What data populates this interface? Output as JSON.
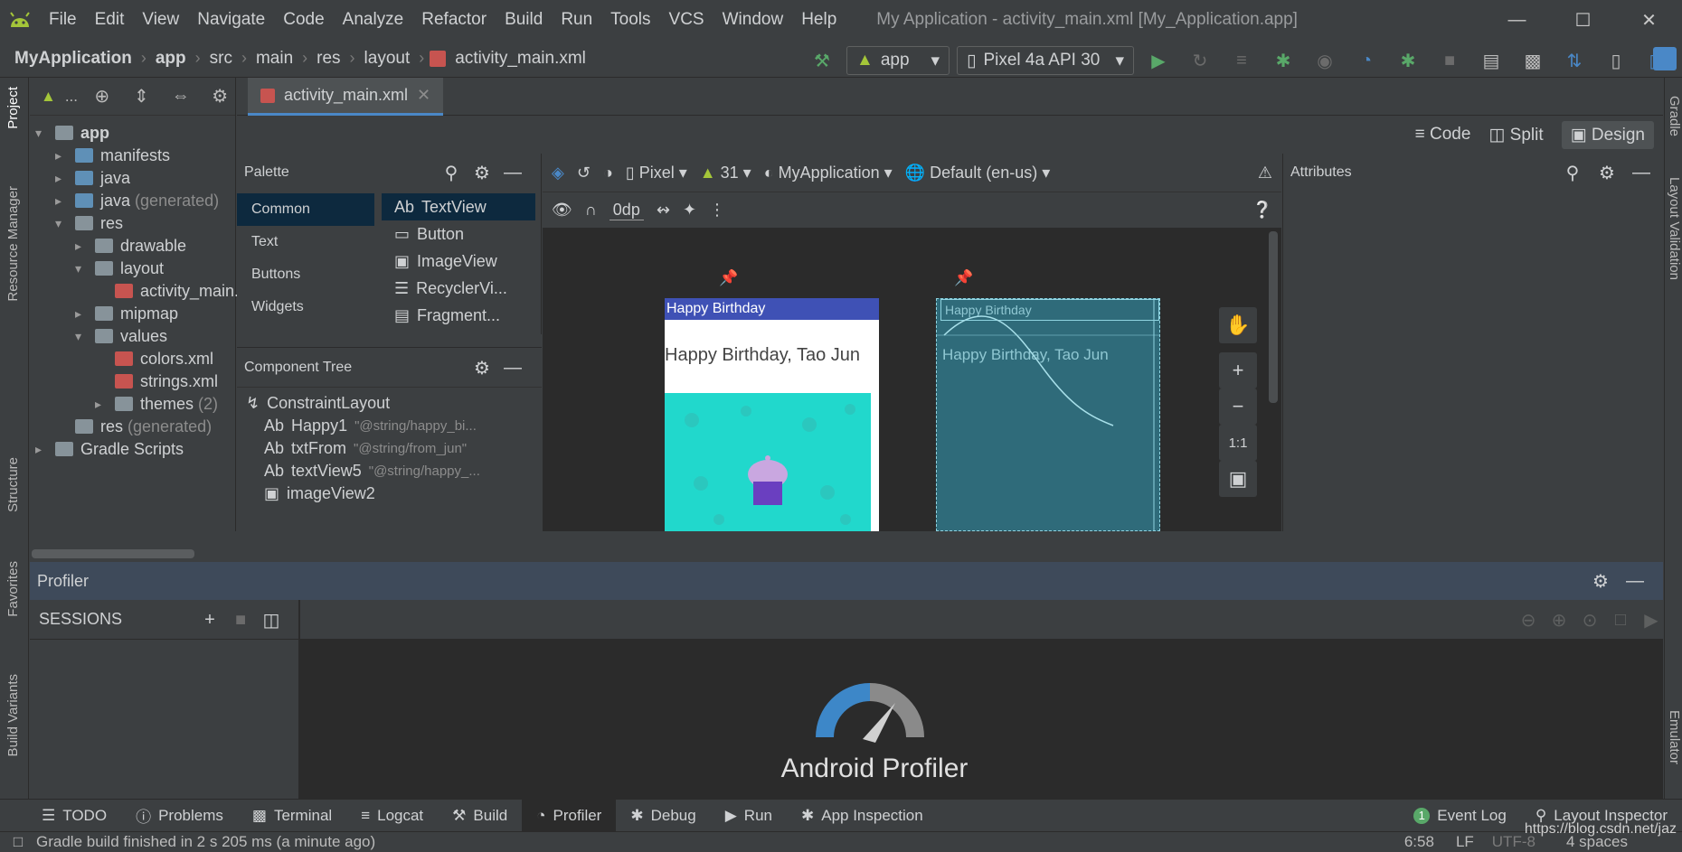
{
  "menubar": {
    "items": [
      "File",
      "Edit",
      "View",
      "Navigate",
      "Code",
      "Analyze",
      "Refactor",
      "Build",
      "Run",
      "Tools",
      "VCS",
      "Window",
      "Help"
    ],
    "title": "My Application - activity_main.xml [My_Application.app]"
  },
  "navbar": {
    "breadcrumbs": [
      "MyApplication",
      "app",
      "src",
      "main",
      "res",
      "layout",
      "activity_main.xml"
    ],
    "run_config": "app",
    "device": "Pixel 4a API 30"
  },
  "left_strip": {
    "project": "Project",
    "resource_manager": "Resource Manager",
    "structure": "Structure",
    "favorites": "Favorites",
    "build_variants": "Build Variants"
  },
  "right_strip": {
    "gradle": "Gradle",
    "layout_validation": "Layout Validation",
    "emulator": "Emulator"
  },
  "project": {
    "toolbar_label": "...",
    "tree": [
      {
        "label": "app"
      },
      {
        "label": "manifests"
      },
      {
        "label": "java"
      },
      {
        "label": "java",
        "suffix": "(generated)"
      },
      {
        "label": "res"
      },
      {
        "label": "drawable"
      },
      {
        "label": "layout"
      },
      {
        "label": "activity_main.xml"
      },
      {
        "label": "mipmap"
      },
      {
        "label": "values"
      },
      {
        "label": "colors.xml"
      },
      {
        "label": "strings.xml"
      },
      {
        "label": "themes",
        "suffix": "(2)"
      },
      {
        "label": "res",
        "suffix": "(generated)"
      },
      {
        "label": "Gradle Scripts"
      }
    ]
  },
  "editor": {
    "tab": "activity_main.xml",
    "view_modes": {
      "code": "Code",
      "split": "Split",
      "design": "Design"
    }
  },
  "palette": {
    "title": "Palette",
    "categories": [
      "Common",
      "Text",
      "Buttons",
      "Widgets"
    ],
    "items": [
      {
        "prefix": "Ab",
        "label": "TextView"
      },
      {
        "prefix": "",
        "label": "Button"
      },
      {
        "prefix": "",
        "label": "ImageView"
      },
      {
        "prefix": "",
        "label": "RecyclerVi..."
      },
      {
        "prefix": "",
        "label": "Fragment..."
      }
    ]
  },
  "component_tree": {
    "title": "Component Tree",
    "items": [
      {
        "label": "ConstraintLayout",
        "hint": ""
      },
      {
        "label": "Happy1",
        "hint": "\"@string/happy_bi..."
      },
      {
        "label": "txtFrom",
        "hint": "\"@string/from_jun\""
      },
      {
        "label": "textView5",
        "hint": "\"@string/happy_..."
      },
      {
        "label": "imageView2",
        "hint": ""
      }
    ]
  },
  "design_toolbar": {
    "device": "Pixel",
    "api": "31",
    "theme": "MyApplication",
    "locale": "Default (en-us)",
    "margin": "0dp"
  },
  "preview": {
    "appbar_title": "Happy Birthday",
    "text": "Happy Birthday, Tao Jun",
    "blueprint_appbar": "Happy Birthday",
    "blueprint_text": "Happy Birthday, Tao Jun"
  },
  "zoom": {
    "fit": "1:1"
  },
  "attributes": {
    "title": "Attributes"
  },
  "profiler": {
    "title": "Profiler",
    "sessions_title": "SESSIONS",
    "center_title": "Android Profiler"
  },
  "toolwindows": [
    "TODO",
    "Problems",
    "Terminal",
    "Logcat",
    "Build",
    "Profiler",
    "Debug",
    "Run",
    "App Inspection"
  ],
  "toolwindows_right": [
    "Event Log",
    "Layout Inspector"
  ],
  "event_log_count": "1",
  "status": {
    "message": "Gradle build finished in 2 s 205 ms (a minute ago)",
    "position": "6:58",
    "line_sep": "LF",
    "encoding": "UTF-8",
    "indent": "4 spaces",
    "watermark": "https://blog.csdn.net/jaz"
  },
  "colors": {
    "accent": "#4a88c7",
    "android": "#a4c639",
    "run": "#59a869",
    "appbar": "#3f51b5",
    "cupcake_bg": "#21d8cc"
  }
}
